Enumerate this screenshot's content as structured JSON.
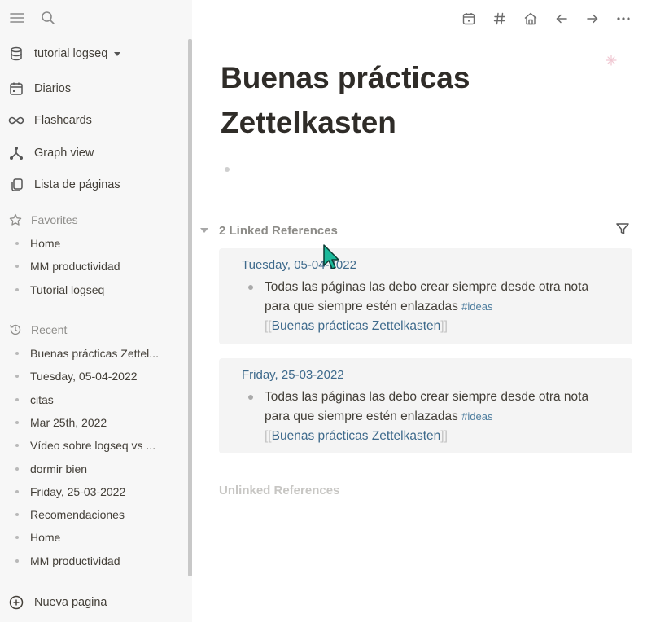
{
  "sidebar": {
    "graph_name": "tutorial logseq",
    "nav": [
      {
        "label": "Diarios",
        "icon": "calendar-icon"
      },
      {
        "label": "Flashcards",
        "icon": "infinity-icon"
      },
      {
        "label": "Graph view",
        "icon": "graph-icon"
      },
      {
        "label": "Lista de páginas",
        "icon": "pages-icon"
      }
    ],
    "favorites_title": "Favorites",
    "favorites": [
      "Home",
      "MM productividad",
      "Tutorial logseq"
    ],
    "recent_title": "Recent",
    "recent": [
      "Buenas prácticas Zettel...",
      "Tuesday, 05-04-2022",
      "citas",
      "Mar 25th, 2022",
      "Vídeo sobre logseq vs ...",
      "dormir bien",
      "Friday, 25-03-2022",
      "Recomendaciones",
      "Home",
      "MM productividad"
    ],
    "new_page_label": "Nueva pagina"
  },
  "page": {
    "title_line1": "Buenas prácticas",
    "title_line2": "Zettelkasten",
    "linked_refs_label": "2 Linked References",
    "unlinked_refs_label": "Unlinked References",
    "references": [
      {
        "date": "Tuesday, 05-04-2022",
        "text": "Todas las páginas las debo crear siempre desde otra nota para que siempre estén enlazadas",
        "tag": "#ideas",
        "link_open": "[[",
        "link": "Buenas prácticas Zettelkasten",
        "link_close": "]]"
      },
      {
        "date": "Friday, 25-03-2022",
        "text": "Todas las páginas las debo crear siempre desde otra nota para que siempre estén enlazadas",
        "tag": "#ideas",
        "link_open": "[[",
        "link": "Buenas prácticas Zettelkasten",
        "link_close": "]]"
      }
    ]
  },
  "colors": {
    "sidebar_bg": "#f7f7f7",
    "link": "#3e6a8c",
    "card_bg": "#f4f4f4",
    "cursor": "#1bb99a"
  }
}
